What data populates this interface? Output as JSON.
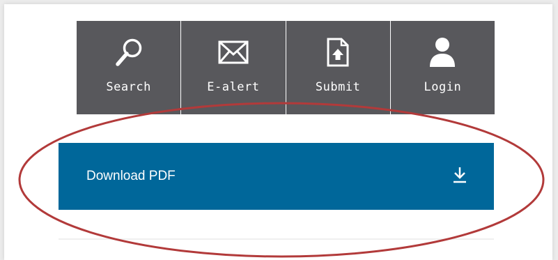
{
  "toolbar": {
    "items": [
      {
        "label": "Search",
        "icon": "search-icon"
      },
      {
        "label": "E-alert",
        "icon": "envelope-icon"
      },
      {
        "label": "Submit",
        "icon": "upload-document-icon"
      },
      {
        "label": "Login",
        "icon": "user-icon"
      }
    ],
    "background_color": "#58585c"
  },
  "download": {
    "label": "Download PDF",
    "icon": "download-icon",
    "background_color": "#00679a"
  },
  "annotation": {
    "shape": "ellipse",
    "stroke_color": "#b23a3a"
  }
}
